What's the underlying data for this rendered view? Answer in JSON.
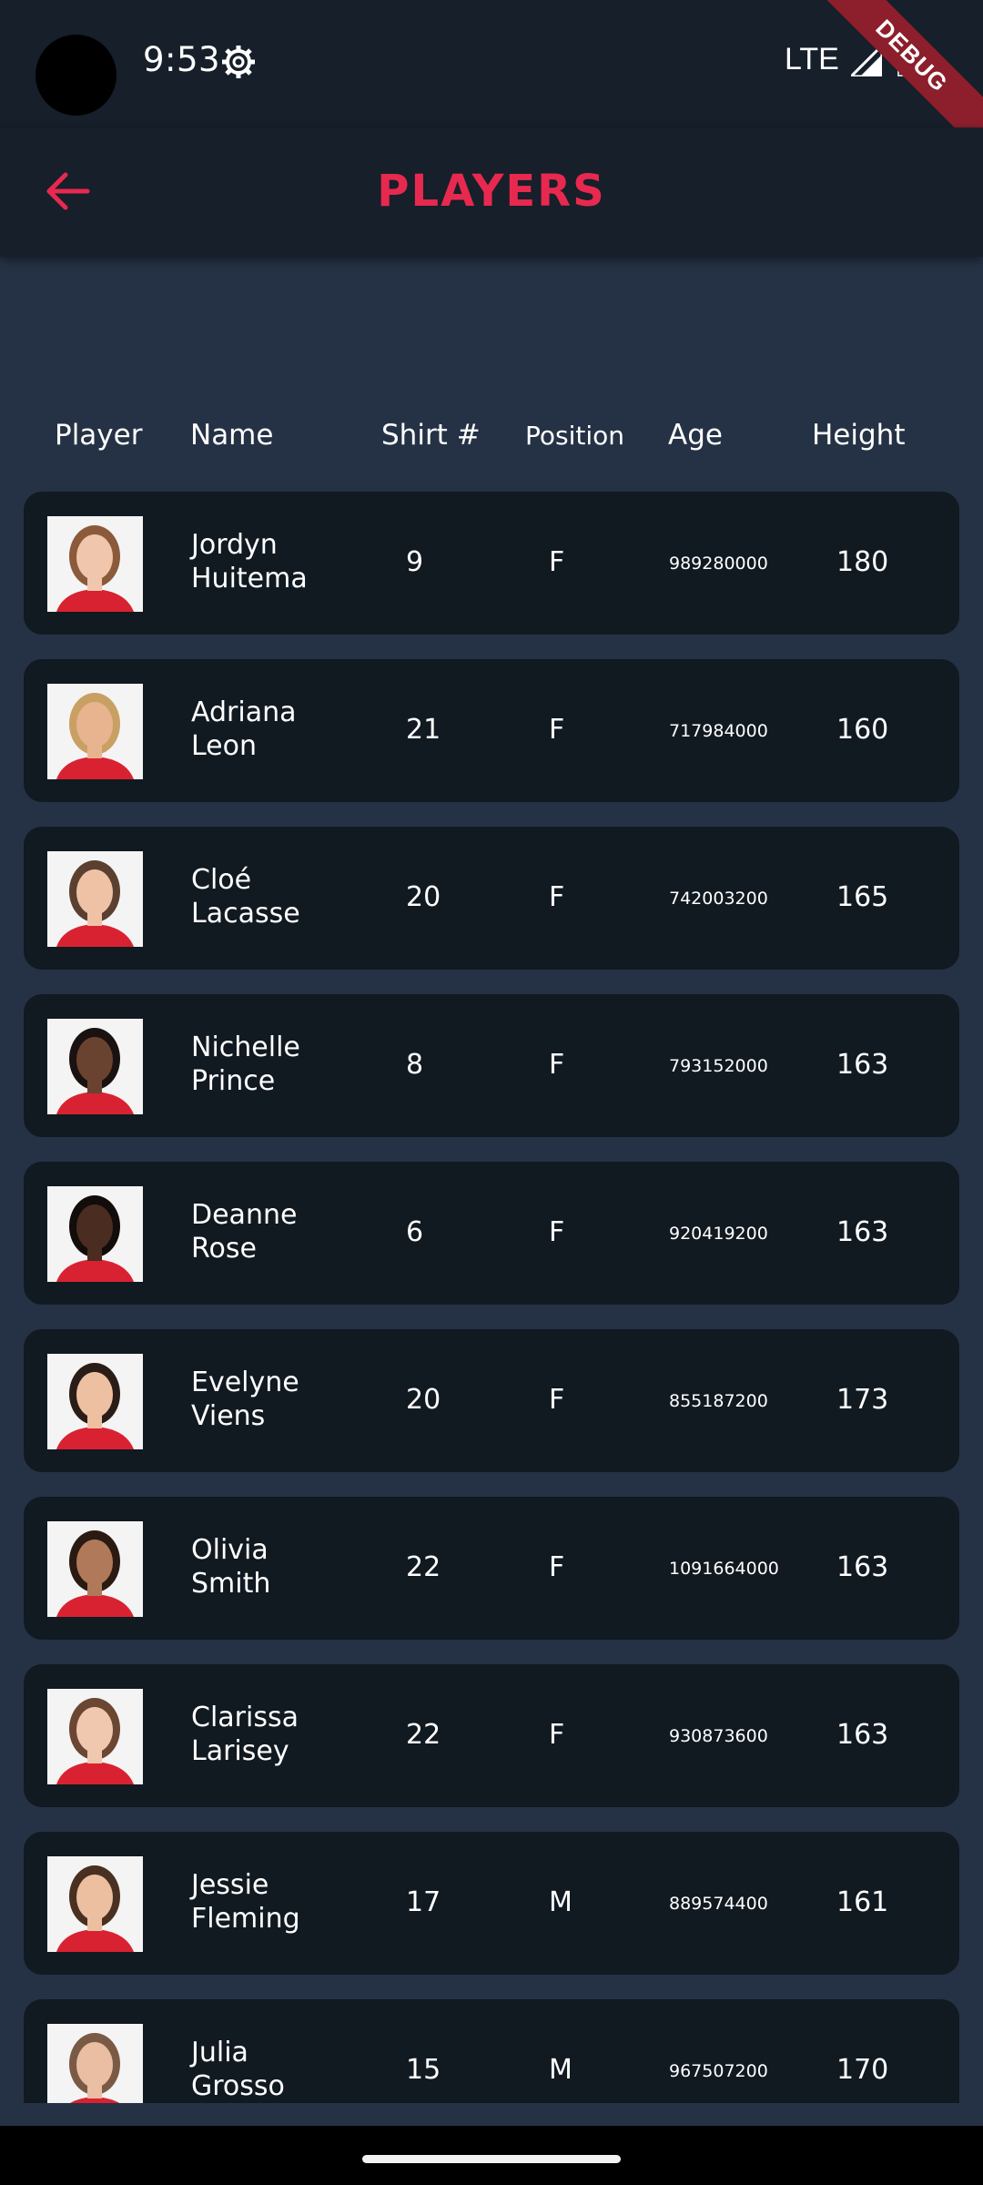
{
  "status": {
    "time": "9:53",
    "network": "LTE",
    "debug_label": "DEBUG"
  },
  "appbar": {
    "title": "PLAYERS"
  },
  "columns": {
    "player": "Player",
    "name": "Name",
    "shirt": "Shirt #",
    "position": "Position",
    "age": "Age",
    "height": "Height"
  },
  "colors": {
    "accent": "#e8294f",
    "background": "#253245",
    "card": "#111921",
    "bar": "#161f2a"
  },
  "players": [
    {
      "first": "Jordyn",
      "last": "Huitema",
      "shirt": "9",
      "position": "F",
      "age": "989280000",
      "height": "180",
      "skin": "#f0c7ad",
      "hair": "#8a5a3a"
    },
    {
      "first": "Adriana",
      "last": "Leon",
      "shirt": "21",
      "position": "F",
      "age": "717984000",
      "height": "160",
      "skin": "#e8b48f",
      "hair": "#c9a063"
    },
    {
      "first": "Cloé",
      "last": "Lacasse",
      "shirt": "20",
      "position": "F",
      "age": "742003200",
      "height": "165",
      "skin": "#efc2a6",
      "hair": "#5b4030"
    },
    {
      "first": "Nichelle",
      "last": "Prince",
      "shirt": "8",
      "position": "F",
      "age": "793152000",
      "height": "163",
      "skin": "#6a4330",
      "hair": "#1a1210"
    },
    {
      "first": "Deanne",
      "last": "Rose",
      "shirt": "6",
      "position": "F",
      "age": "920419200",
      "height": "163",
      "skin": "#4a2c20",
      "hair": "#120c0a"
    },
    {
      "first": "Evelyne",
      "last": "Viens",
      "shirt": "20",
      "position": "F",
      "age": "855187200",
      "height": "173",
      "skin": "#eec0a2",
      "hair": "#2a1d18"
    },
    {
      "first": "Olivia",
      "last": "Smith",
      "shirt": "22",
      "position": "F",
      "age": "1091664000",
      "height": "163",
      "skin": "#b07a5a",
      "hair": "#2a1a12"
    },
    {
      "first": "Clarissa",
      "last": "Larisey",
      "shirt": "22",
      "position": "F",
      "age": "930873600",
      "height": "163",
      "skin": "#f0c8b0",
      "hair": "#6b4632"
    },
    {
      "first": "Jessie",
      "last": "Fleming",
      "shirt": "17",
      "position": "M",
      "age": "889574400",
      "height": "161",
      "skin": "#ecbfa0",
      "hair": "#4a3020"
    },
    {
      "first": "Julia",
      "last": "Grosso",
      "shirt": "15",
      "position": "M",
      "age": "967507200",
      "height": "170",
      "skin": "#e9bea2",
      "hair": "#7a5a44"
    }
  ]
}
